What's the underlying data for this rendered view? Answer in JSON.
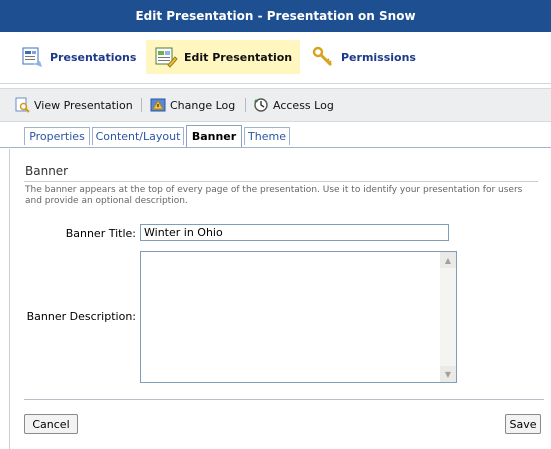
{
  "window": {
    "title": "Edit Presentation - Presentation on Snow"
  },
  "nav": {
    "items": [
      {
        "label": "Presentations",
        "icon": "presentations-icon"
      },
      {
        "label": "Edit Presentation",
        "icon": "edit-presentation-icon",
        "active": true
      },
      {
        "label": "Permissions",
        "icon": "permissions-key-icon"
      }
    ]
  },
  "toolbar": {
    "items": [
      {
        "label": "View Presentation",
        "icon": "view-presentation-icon"
      },
      {
        "label": "Change Log",
        "icon": "change-log-icon"
      },
      {
        "label": "Access Log",
        "icon": "access-log-icon"
      }
    ]
  },
  "tabs": [
    {
      "label": "Properties"
    },
    {
      "label": "Content/Layout"
    },
    {
      "label": "Banner",
      "active": true
    },
    {
      "label": "Theme"
    }
  ],
  "banner": {
    "heading": "Banner",
    "description": "The banner appears at the top of every page of the presentation. Use it to identify your presentation for users and provide an optional description.",
    "title_label": "Banner Title:",
    "title_value": "Winter in Ohio",
    "description_label": "Banner Description:",
    "description_value": ""
  },
  "buttons": {
    "cancel": "Cancel",
    "save": "Save"
  },
  "colors": {
    "titlebar": "#1d4f91",
    "active_nav": "#fff7bf",
    "tab_border": "#9fb4cc"
  }
}
